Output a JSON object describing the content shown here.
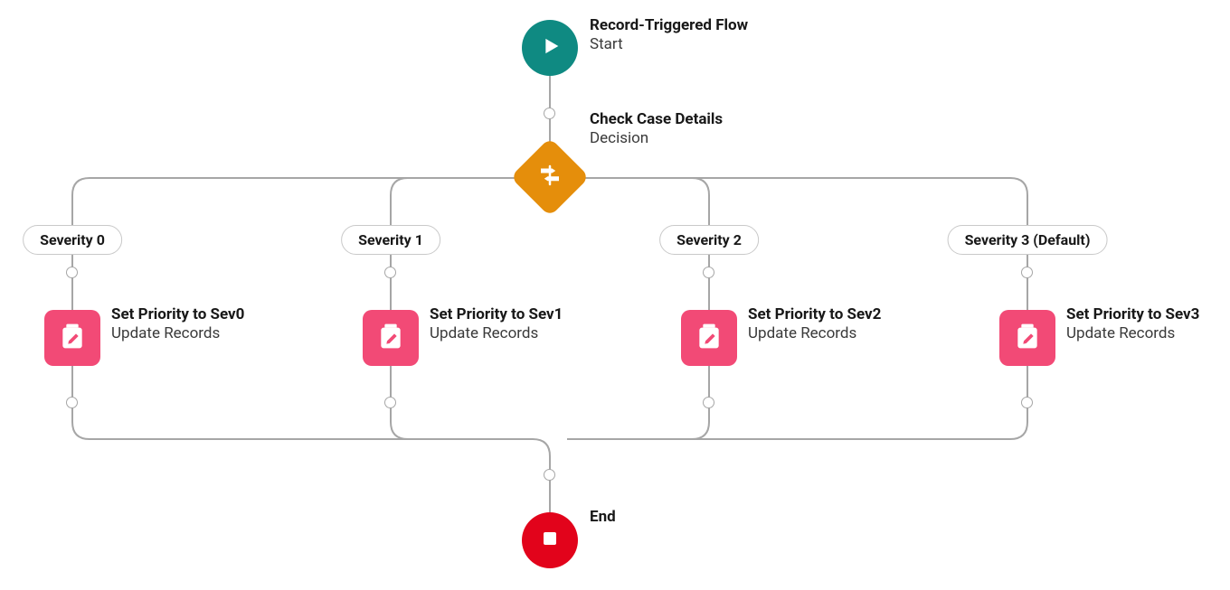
{
  "start": {
    "title": "Record-Triggered Flow",
    "subtitle": "Start",
    "icon": "play-icon"
  },
  "decision": {
    "title": "Check Case Details",
    "subtitle": "Decision",
    "icon": "signpost-icon"
  },
  "branches": [
    {
      "label": "Severity 0",
      "action_title": "Set Priority to Sev0",
      "action_subtitle": "Update Records"
    },
    {
      "label": "Severity 1",
      "action_title": "Set Priority to Sev1",
      "action_subtitle": "Update Records"
    },
    {
      "label": "Severity 2",
      "action_title": "Set Priority to Sev2",
      "action_subtitle": "Update Records"
    },
    {
      "label": "Severity 3 (Default)",
      "action_title": "Set Priority to Sev3",
      "action_subtitle": "Update Records"
    }
  ],
  "end": {
    "title": "End",
    "icon": "stop-icon"
  },
  "icons": {
    "update_records": "clipboard-edit-icon"
  },
  "colors": {
    "start": "#0f8a82",
    "decision": "#e58e0b",
    "update": "#f24a76",
    "end": "#e2031b",
    "connector": "#a6a6a6"
  }
}
